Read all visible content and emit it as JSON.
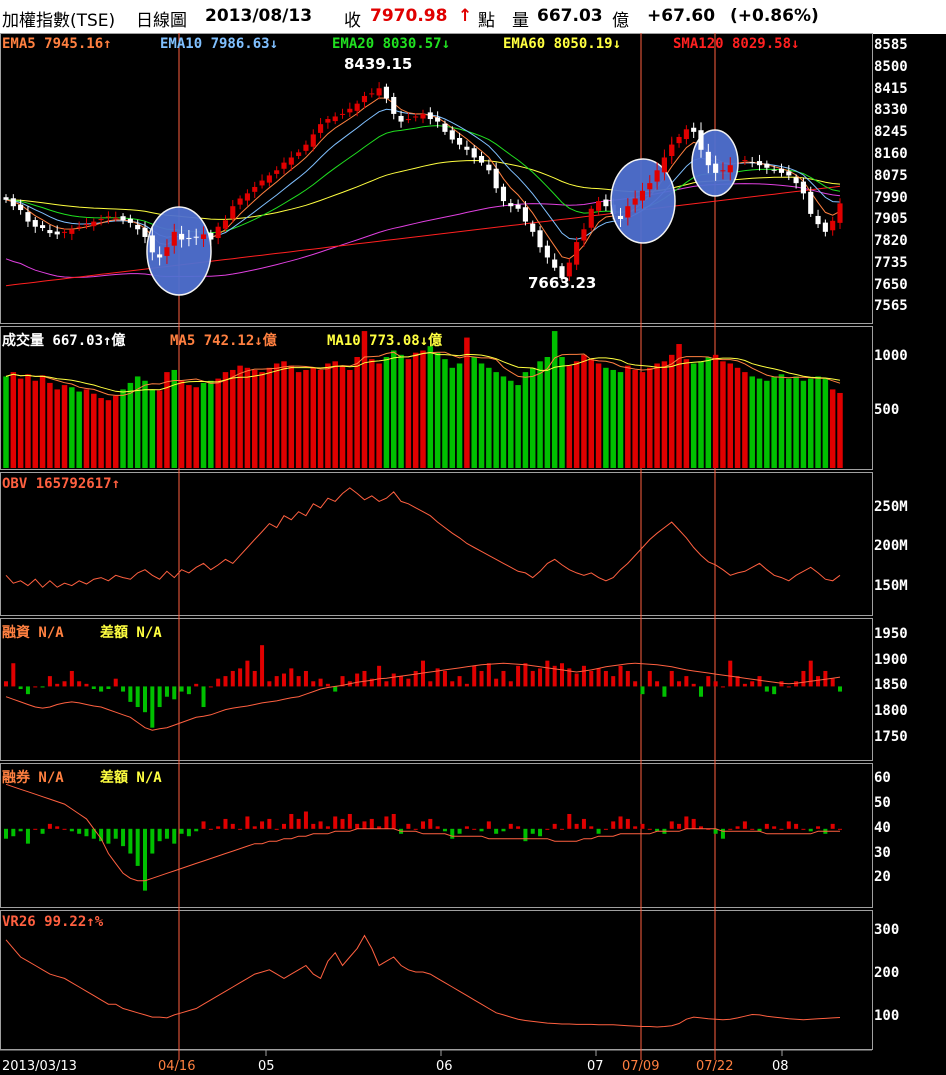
{
  "header": {
    "name": "加權指數(TSE)",
    "period": "日線圖",
    "date": "2013/08/13",
    "close_label": "收",
    "close": "7970.98",
    "close_arrow": "↑",
    "unit_points": "點",
    "volume_label": "量",
    "volume": "667.03",
    "volume_unit": "億",
    "change": "+67.60",
    "change_pct": "(+0.86%)"
  },
  "colors": {
    "up": "#e00000",
    "down": "#00c000",
    "ema5": "#ff8040",
    "ema10": "#80c0ff",
    "ema20": "#20e020",
    "ema60": "#ffff40",
    "sma120": "#ff2020",
    "purple": "#e040e0",
    "vline": "#ff6040",
    "ellipse": "#5070d0",
    "grid": "#a0a0a0",
    "indicator_line": "#ff6040"
  },
  "legend": {
    "ema5": "EMA5 7945.16↑",
    "ema10": "EMA10 7986.63↓",
    "ema20": "EMA20 8030.57↓",
    "ema60": "EMA60 8050.19↓",
    "sma120": "SMA120 8029.58↓",
    "vol": "成交量 667.03↑億",
    "vol_ma5": "MA5 742.12↓億",
    "vol_ma10": "MA10 773.08↓億",
    "obv": "OBV 165792617↑",
    "margin": "融資 N/A",
    "margin_diff": "差額 N/A",
    "short": "融券 N/A",
    "short_diff": "差額 N/A",
    "vr": "VR26 99.22↑%"
  },
  "annotations": {
    "high": "8439.15",
    "low": "7663.23"
  },
  "x_ticks": [
    "2013/03/13",
    "04/16",
    "05",
    "06",
    "07",
    "07/09",
    "07/22",
    "08"
  ],
  "chart_data": [
    {
      "type": "candlestick",
      "title": "加權指數(TSE) 日線圖",
      "ylim": [
        7520,
        8620
      ],
      "y_ticks": [
        8585,
        8500,
        8415,
        8330,
        8245,
        8160,
        8075,
        7990,
        7905,
        7820,
        7735,
        7650,
        7565
      ],
      "x_ticks": [
        "2013/03/13",
        "04/16",
        "05",
        "06",
        "07",
        "07/09",
        "07/22",
        "08"
      ],
      "close": [
        7985,
        7960,
        7945,
        7900,
        7880,
        7875,
        7855,
        7850,
        7860,
        7870,
        7880,
        7890,
        7900,
        7910,
        7920,
        7915,
        7905,
        7895,
        7870,
        7840,
        7780,
        7760,
        7800,
        7860,
        7830,
        7835,
        7840,
        7850,
        7830,
        7880,
        7905,
        7960,
        7990,
        8010,
        8035,
        8060,
        8080,
        8100,
        8130,
        8150,
        8170,
        8200,
        8240,
        8280,
        8300,
        8310,
        8320,
        8340,
        8360,
        8390,
        8400,
        8420,
        8380,
        8320,
        8290,
        8300,
        8310,
        8320,
        8300,
        8290,
        8250,
        8220,
        8200,
        8180,
        8150,
        8130,
        8100,
        8030,
        7980,
        7960,
        7950,
        7900,
        7860,
        7800,
        7760,
        7720,
        7680,
        7740,
        7820,
        7870,
        7950,
        7980,
        7960,
        7930,
        7910,
        7960,
        7990,
        8020,
        8050,
        8100,
        8150,
        8200,
        8230,
        8260,
        8250,
        8180,
        8120,
        8090,
        8100,
        8120,
        8130,
        8140,
        8130,
        8120,
        8110,
        8100,
        8090,
        8080,
        8050,
        8010,
        7930,
        7890,
        7860,
        7903,
        7971
      ],
      "highlight_ellipses": [
        "04/16",
        "07/09",
        "07/22"
      ],
      "series": [
        {
          "name": "EMA5",
          "last": 7945.16
        },
        {
          "name": "EMA10",
          "last": 7986.63
        },
        {
          "name": "EMA20",
          "last": 8030.57
        },
        {
          "name": "EMA60",
          "last": 8050.19
        },
        {
          "name": "SMA120",
          "last": 8029.58
        }
      ],
      "annotations": [
        {
          "text": "8439.15",
          "kind": "high"
        },
        {
          "text": "7663.23",
          "kind": "low"
        }
      ]
    },
    {
      "type": "bar",
      "title": "成交量",
      "ylim": [
        0,
        1250
      ],
      "y_ticks": [
        1000,
        500
      ],
      "values": [
        820,
        860,
        800,
        840,
        780,
        830,
        760,
        700,
        740,
        720,
        680,
        700,
        660,
        620,
        600,
        640,
        700,
        760,
        820,
        780,
        700,
        690,
        860,
        880,
        780,
        740,
        720,
        760,
        780,
        800,
        860,
        880,
        920,
        900,
        880,
        860,
        900,
        940,
        960,
        920,
        860,
        880,
        900,
        880,
        940,
        960,
        920,
        880,
        1000,
        1240,
        980,
        940,
        1000,
        1060,
        1020,
        980,
        1040,
        1060,
        1100,
        1040,
        980,
        900,
        940,
        1180,
        1000,
        940,
        900,
        860,
        820,
        780,
        740,
        860,
        900,
        960,
        1000,
        1240,
        1000,
        920,
        960,
        1020,
        980,
        940,
        900,
        880,
        860,
        920,
        880,
        860,
        900,
        940,
        960,
        1020,
        1120,
        980,
        940,
        960,
        1000,
        1020,
        960,
        940,
        900,
        860,
        820,
        800,
        780,
        820,
        840,
        800,
        820,
        780,
        800,
        820,
        800,
        700,
        667
      ],
      "up": [
        false,
        true,
        true,
        true,
        true,
        true,
        true,
        true,
        true,
        false,
        false,
        true,
        true,
        true,
        true,
        true,
        false,
        false,
        false,
        false,
        false,
        true,
        true,
        false,
        true,
        true,
        true,
        false,
        false,
        true,
        true,
        true,
        true,
        true,
        true,
        true,
        true,
        true,
        true,
        true,
        true,
        true,
        true,
        true,
        true,
        true,
        true,
        true,
        true,
        true,
        true,
        true,
        false,
        false,
        false,
        true,
        true,
        true,
        false,
        false,
        false,
        false,
        false,
        true,
        false,
        false,
        false,
        false,
        false,
        false,
        false,
        false,
        false,
        false,
        false,
        false,
        false,
        true,
        true,
        true,
        true,
        true,
        false,
        false,
        false,
        true,
        true,
        true,
        true,
        true,
        true,
        true,
        true,
        true,
        false,
        false,
        false,
        true,
        true,
        true,
        true,
        true,
        false,
        false,
        false,
        false,
        false,
        false,
        false,
        false,
        false,
        false,
        false,
        true,
        true
      ],
      "ma_last": {
        "MA5": 742.12,
        "MA10": 773.08
      },
      "last": 667.03
    },
    {
      "type": "line",
      "title": "OBV",
      "ylim": [
        120,
        290
      ],
      "y_ticks_labels": [
        "250M",
        "200M",
        "150M"
      ],
      "y_ticks": [
        250,
        200,
        150
      ],
      "values": [
        165,
        155,
        158,
        152,
        160,
        150,
        158,
        150,
        155,
        152,
        158,
        154,
        160,
        162,
        158,
        165,
        162,
        160,
        168,
        172,
        165,
        160,
        170,
        162,
        172,
        168,
        175,
        180,
        172,
        178,
        185,
        180,
        190,
        200,
        210,
        220,
        230,
        225,
        240,
        235,
        245,
        240,
        255,
        250,
        262,
        258,
        268,
        275,
        268,
        260,
        265,
        258,
        262,
        270,
        258,
        255,
        250,
        245,
        240,
        232,
        225,
        218,
        212,
        205,
        200,
        195,
        190,
        185,
        180,
        175,
        170,
        168,
        162,
        170,
        180,
        185,
        178,
        172,
        168,
        165,
        168,
        162,
        158,
        162,
        172,
        180,
        190,
        200,
        210,
        218,
        225,
        232,
        222,
        212,
        200,
        190,
        182,
        178,
        172,
        165,
        168,
        170,
        175,
        180,
        172,
        165,
        162,
        158,
        165,
        170,
        175,
        168,
        160,
        158,
        165
      ],
      "last": 165792617
    },
    {
      "type": "bar",
      "title": "融資",
      "ylim": [
        1715,
        1975
      ],
      "y_ticks": [
        1950,
        1900,
        1850,
        1800,
        1750
      ],
      "baseline": 1850,
      "values": [
        1860,
        1895,
        1845,
        1835,
        1850,
        1848,
        1870,
        1855,
        1860,
        1880,
        1860,
        1855,
        1845,
        1840,
        1845,
        1865,
        1840,
        1820,
        1810,
        1800,
        1770,
        1810,
        1830,
        1825,
        1840,
        1835,
        1855,
        1810,
        1850,
        1865,
        1870,
        1880,
        1885,
        1900,
        1880,
        1930,
        1860,
        1870,
        1875,
        1885,
        1870,
        1880,
        1860,
        1865,
        1855,
        1840,
        1870,
        1860,
        1875,
        1880,
        1865,
        1890,
        1860,
        1875,
        1870,
        1865,
        1880,
        1900,
        1860,
        1885,
        1880,
        1860,
        1870,
        1855,
        1890,
        1880,
        1895,
        1865,
        1880,
        1860,
        1890,
        1895,
        1880,
        1885,
        1900,
        1890,
        1895,
        1885,
        1875,
        1890,
        1880,
        1885,
        1880,
        1870,
        1890,
        1880,
        1860,
        1835,
        1880,
        1860,
        1830,
        1880,
        1860,
        1870,
        1855,
        1830,
        1870,
        1860,
        1850,
        1900,
        1870,
        1855,
        1860,
        1870,
        1840,
        1835,
        1860,
        1850,
        1860,
        1880,
        1900,
        1870,
        1880,
        1865,
        1840
      ],
      "ma_line": [
        1830,
        1825,
        1820,
        1815,
        1810,
        1808,
        1810,
        1815,
        1818,
        1820,
        1818,
        1815,
        1812,
        1810,
        1805,
        1800,
        1795,
        1790,
        1780,
        1770,
        1765,
        1768,
        1770,
        1775,
        1780,
        1785,
        1790,
        1792,
        1795,
        1800,
        1805,
        1808,
        1810,
        1812,
        1815,
        1818,
        1820,
        1822,
        1825,
        1828,
        1830,
        1835,
        1840,
        1845,
        1848,
        1850,
        1852,
        1855,
        1858,
        1860,
        1862,
        1865,
        1866,
        1868,
        1870,
        1872,
        1874,
        1876,
        1878,
        1880,
        1882,
        1884,
        1886,
        1888,
        1890,
        1892,
        1893,
        1894,
        1895,
        1894,
        1893,
        1892,
        1890,
        1888,
        1886,
        1884,
        1882,
        1880,
        1878,
        1880,
        1882,
        1885,
        1888,
        1890,
        1892,
        1894,
        1895,
        1894,
        1893,
        1892,
        1890,
        1888,
        1885,
        1882,
        1880,
        1878,
        1876,
        1874,
        1872,
        1870,
        1868,
        1866,
        1864,
        1862,
        1860,
        1858,
        1856,
        1855,
        1856,
        1858,
        1860,
        1862,
        1864,
        1866,
        1868
      ]
    },
    {
      "type": "bar",
      "title": "融券",
      "ylim": [
        10,
        65
      ],
      "y_ticks": [
        60,
        50,
        40,
        30,
        20
      ],
      "baseline": 40,
      "values": [
        36,
        37,
        39,
        34,
        40,
        38,
        42,
        41,
        40,
        39,
        38,
        37,
        36,
        35,
        34,
        36,
        33,
        30,
        25,
        15,
        30,
        35,
        36,
        34,
        38,
        37,
        39,
        43,
        40,
        41,
        44,
        42,
        40,
        45,
        41,
        43,
        44,
        40,
        42,
        46,
        44,
        47,
        42,
        43,
        41,
        45,
        44,
        46,
        42,
        43,
        44,
        41,
        45,
        46,
        38,
        42,
        40,
        43,
        44,
        41,
        39,
        36,
        38,
        41,
        40,
        39,
        43,
        38,
        39,
        42,
        41,
        35,
        38,
        37,
        40,
        42,
        40,
        46,
        42,
        44,
        41,
        38,
        40,
        43,
        45,
        44,
        41,
        42,
        40,
        39,
        38,
        43,
        42,
        45,
        44,
        41,
        40,
        38,
        36,
        40,
        41,
        43,
        40,
        39,
        42,
        41,
        40,
        43,
        42,
        40,
        39,
        41,
        38,
        42,
        40
      ],
      "ma_line": [
        58,
        57,
        56,
        55,
        54,
        53,
        52,
        51,
        50,
        48,
        46,
        44,
        40,
        36,
        30,
        26,
        22,
        20,
        19,
        19,
        20,
        21,
        22,
        23,
        24,
        25,
        26,
        27,
        28,
        29,
        30,
        31,
        32,
        33,
        34,
        34,
        35,
        35,
        36,
        36,
        37,
        37,
        38,
        38,
        38,
        39,
        39,
        39,
        40,
        40,
        40,
        40,
        40,
        40,
        39,
        39,
        39,
        38,
        38,
        38,
        38,
        37,
        37,
        37,
        37,
        37,
        36,
        36,
        36,
        36,
        36,
        36,
        36,
        36,
        36,
        35,
        35,
        35,
        35,
        36,
        36,
        37,
        37,
        37,
        38,
        38,
        38,
        38,
        38,
        39,
        39,
        39,
        39,
        40,
        40,
        40,
        40,
        40,
        39,
        39,
        39,
        39,
        39,
        39,
        38,
        38,
        38,
        38,
        38,
        38,
        38,
        39,
        39,
        39,
        39
      ]
    },
    {
      "type": "line",
      "title": "VR26",
      "ylim": [
        35,
        340
      ],
      "y_ticks": [
        300,
        200,
        100
      ],
      "values": [
        280,
        260,
        240,
        230,
        220,
        210,
        200,
        195,
        190,
        180,
        170,
        160,
        150,
        140,
        130,
        130,
        120,
        115,
        110,
        105,
        100,
        100,
        98,
        105,
        110,
        115,
        120,
        130,
        140,
        150,
        160,
        170,
        180,
        190,
        200,
        205,
        210,
        200,
        190,
        200,
        210,
        220,
        200,
        190,
        230,
        250,
        220,
        240,
        260,
        290,
        260,
        220,
        230,
        240,
        220,
        210,
        205,
        205,
        200,
        190,
        180,
        170,
        160,
        150,
        140,
        130,
        120,
        110,
        105,
        100,
        95,
        92,
        90,
        88,
        86,
        85,
        84,
        84,
        83,
        83,
        83,
        82,
        82,
        82,
        81,
        80,
        79,
        78,
        78,
        77,
        78,
        80,
        85,
        95,
        100,
        98,
        96,
        95,
        94,
        95,
        98,
        102,
        106,
        105,
        102,
        100,
        98,
        96,
        95,
        94,
        95,
        96,
        97,
        98,
        99
      ]
    }
  ]
}
